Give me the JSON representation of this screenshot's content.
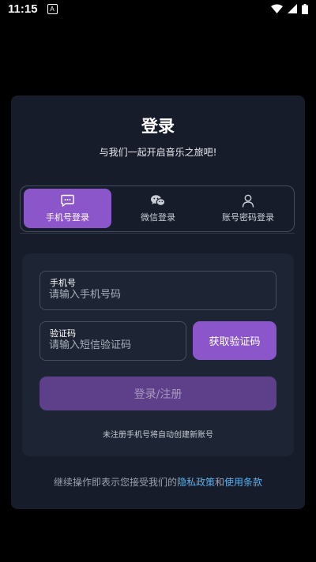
{
  "status_bar": {
    "time": "11:15",
    "notification_glyph": "A",
    "icons": [
      "wifi-icon",
      "signal-icon",
      "battery-icon"
    ]
  },
  "login": {
    "title": "登录",
    "subtitle": "与我们一起开启音乐之旅吧!"
  },
  "tabs": [
    {
      "label": "手机号登录",
      "icon": "message-icon",
      "active": true
    },
    {
      "label": "微信登录",
      "icon": "wechat-icon",
      "active": false
    },
    {
      "label": "账号密码登录",
      "icon": "user-icon",
      "active": false
    }
  ],
  "form": {
    "phone_label": "手机号",
    "phone_placeholder": "请输入手机号码",
    "phone_value": "",
    "code_label": "验证码",
    "code_placeholder": "请输入短信验证码",
    "code_value": "",
    "get_code_button": "获取验证码",
    "submit_button": "登录/注册",
    "note": "未注册手机号将自动创建新账号"
  },
  "agreement": {
    "prefix": "继续操作即表示您接受我们的",
    "privacy_link": "隐私政策",
    "connector": "和",
    "terms_link": "使用条款"
  },
  "colors": {
    "accent": "#8b56c9",
    "card_bg": "#161c2a",
    "link": "#5ab0ee"
  }
}
